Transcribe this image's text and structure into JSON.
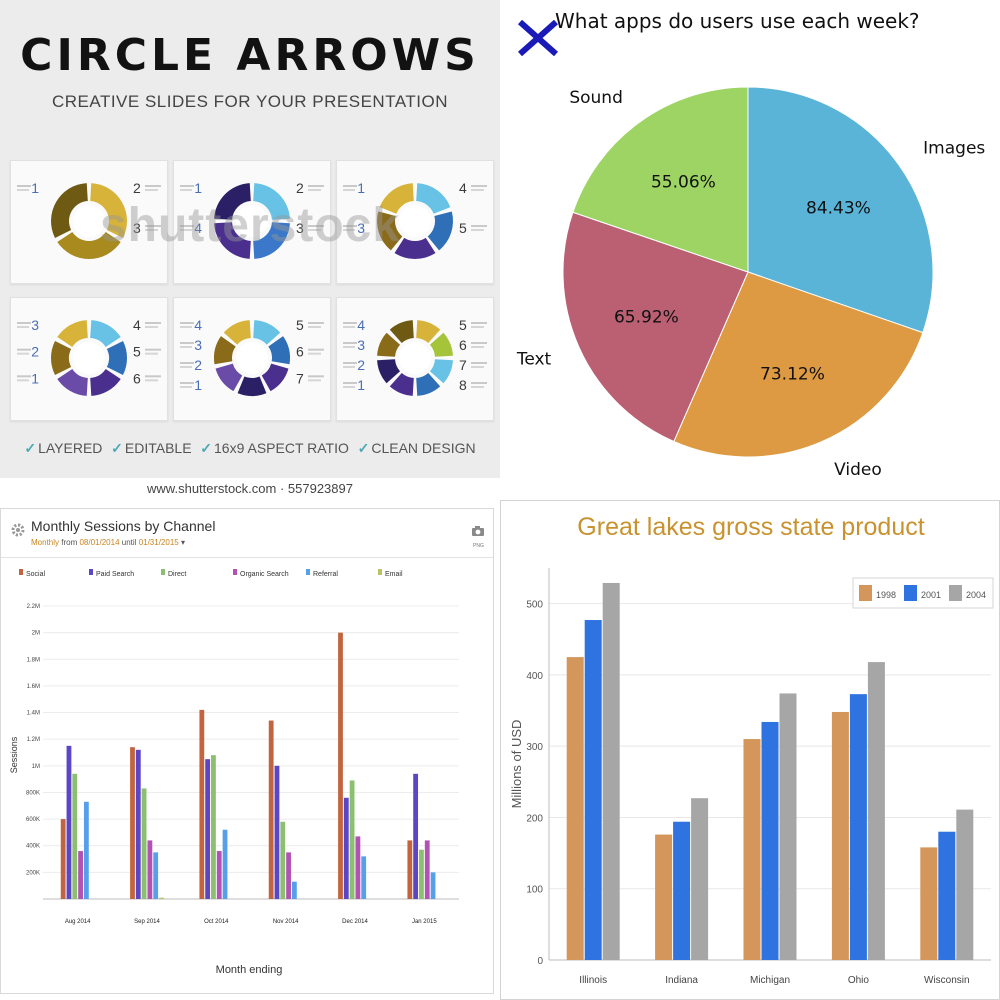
{
  "promo": {
    "title": "CIRCLE ARROWS",
    "subtitle": "CREATIVE SLIDES FOR YOUR PRESENTATION",
    "watermark": "shutterstock",
    "features": [
      "LAYERED",
      "EDITABLE",
      "16x9 ASPECT RATIO",
      "CLEAN DESIGN"
    ],
    "footer": "www.shutterstock.com · 557923897",
    "cards": [
      {
        "segments": 3,
        "numbers_left": [
          "1"
        ],
        "numbers_right": [
          "2",
          "3"
        ],
        "palette": [
          "#d8b33a",
          "#a88a1e",
          "#6f5a14"
        ]
      },
      {
        "segments": 4,
        "numbers_left": [
          "1",
          "4"
        ],
        "numbers_right": [
          "2",
          "3"
        ],
        "palette": [
          "#67c2e6",
          "#3b78c9",
          "#4a2f8f",
          "#2b1f66"
        ]
      },
      {
        "segments": 5,
        "numbers_left": [
          "1",
          "3"
        ],
        "numbers_right": [
          "4",
          "5"
        ],
        "palette": [
          "#67c2e6",
          "#2f6fb7",
          "#4a2f8f",
          "#8a6b1a",
          "#d8b33a"
        ]
      },
      {
        "segments": 6,
        "numbers_left": [
          "3",
          "2",
          "1"
        ],
        "numbers_right": [
          "4",
          "5",
          "6"
        ],
        "palette": [
          "#67c2e6",
          "#2f6fb7",
          "#4a2f8f",
          "#6b4ba8",
          "#8a6b1a",
          "#d8b33a"
        ]
      },
      {
        "segments": 7,
        "numbers_left": [
          "4",
          "3",
          "2",
          "1"
        ],
        "numbers_right": [
          "5",
          "6",
          "7"
        ],
        "palette": [
          "#67c2e6",
          "#2f6fb7",
          "#4a2f8f",
          "#2b1f66",
          "#6b4ba8",
          "#8a6b1a",
          "#d8b33a"
        ]
      },
      {
        "segments": 8,
        "numbers_left": [
          "4",
          "3",
          "2",
          "1"
        ],
        "numbers_right": [
          "5",
          "6",
          "7",
          "8"
        ],
        "palette": [
          "#d8b33a",
          "#a6c43a",
          "#67c2e6",
          "#2f6fb7",
          "#4a2f8f",
          "#2b1f66",
          "#8a6b1a",
          "#6f5a14"
        ]
      }
    ]
  },
  "pie": {
    "close_icon": "close-x-icon",
    "close_color": "#1a1ab8"
  },
  "sessions": {
    "gear_icon": "gear-icon",
    "camera_icon": "camera-icon",
    "png_label": "PNG",
    "subtitle": {
      "prefix": "Monthly",
      "from_word": "from",
      "from": "08/01/2014",
      "until_word": "until",
      "until": "01/31/2015",
      "caret": "▾"
    }
  },
  "chart_data": [
    {
      "type": "pie",
      "title": "What apps do users use each week?",
      "labels": [
        "Images",
        "Video",
        "Text",
        "Sound"
      ],
      "values": [
        84.43,
        73.12,
        65.92,
        55.06
      ],
      "value_labels": [
        "84.43%",
        "73.12%",
        "65.92%",
        "55.06%"
      ],
      "colors": [
        "#5ab4d8",
        "#dd9a43",
        "#bb5f73",
        "#9dd463"
      ],
      "start": "top, clockwise"
    },
    {
      "type": "bar",
      "title": "Monthly Sessions by Channel",
      "xlabel": "Month ending",
      "ylabel": "Sessions",
      "categories": [
        "Aug 2014",
        "Sep 2014",
        "Oct 2014",
        "Nov 2014",
        "Dec 2014",
        "Jan 2015"
      ],
      "ylim": [
        0,
        2200000
      ],
      "yticks": [
        "200K",
        "400K",
        "600K",
        "800K",
        "1M",
        "1.2M",
        "1.4M",
        "1.6M",
        "1.8M",
        "2M",
        "2.2M"
      ],
      "ytick_values": [
        200000,
        400000,
        600000,
        800000,
        1000000,
        1200000,
        1400000,
        1600000,
        1800000,
        2000000,
        2200000
      ],
      "legend_position": "top",
      "grid": true,
      "series": [
        {
          "name": "Social",
          "color": "#c2643f",
          "values": [
            600000,
            1140000,
            1420000,
            1340000,
            2000000,
            440000
          ]
        },
        {
          "name": "Paid Search",
          "color": "#5a46c7",
          "values": [
            1150000,
            1120000,
            1050000,
            1000000,
            760000,
            940000
          ]
        },
        {
          "name": "Direct",
          "color": "#8cbf6f",
          "values": [
            940000,
            830000,
            1080000,
            580000,
            890000,
            370000
          ]
        },
        {
          "name": "Organic Search",
          "color": "#b152b4",
          "values": [
            360000,
            440000,
            360000,
            350000,
            470000,
            440000
          ]
        },
        {
          "name": "Referral",
          "color": "#55a0e8",
          "values": [
            730000,
            350000,
            520000,
            130000,
            320000,
            200000
          ]
        },
        {
          "name": "Email",
          "color": "#bcc166",
          "values": [
            0,
            10000,
            0,
            0,
            0,
            0
          ]
        }
      ]
    },
    {
      "type": "bar",
      "title": "Great lakes gross state product",
      "ylabel": "Millions of USD",
      "categories": [
        "Illinois",
        "Indiana",
        "Michigan",
        "Ohio",
        "Wisconsin"
      ],
      "ylim": [
        0,
        550
      ],
      "yticks": [
        0,
        100,
        200,
        300,
        400,
        500
      ],
      "legend_position": "top-right",
      "grid": true,
      "series": [
        {
          "name": "1998",
          "color": "#d4965a",
          "values": [
            425,
            176,
            310,
            348,
            158
          ]
        },
        {
          "name": "2001",
          "color": "#2f73e0",
          "values": [
            477,
            194,
            334,
            373,
            180
          ]
        },
        {
          "name": "2004",
          "color": "#a6a6a6",
          "values": [
            529,
            227,
            374,
            418,
            211
          ]
        }
      ]
    }
  ]
}
